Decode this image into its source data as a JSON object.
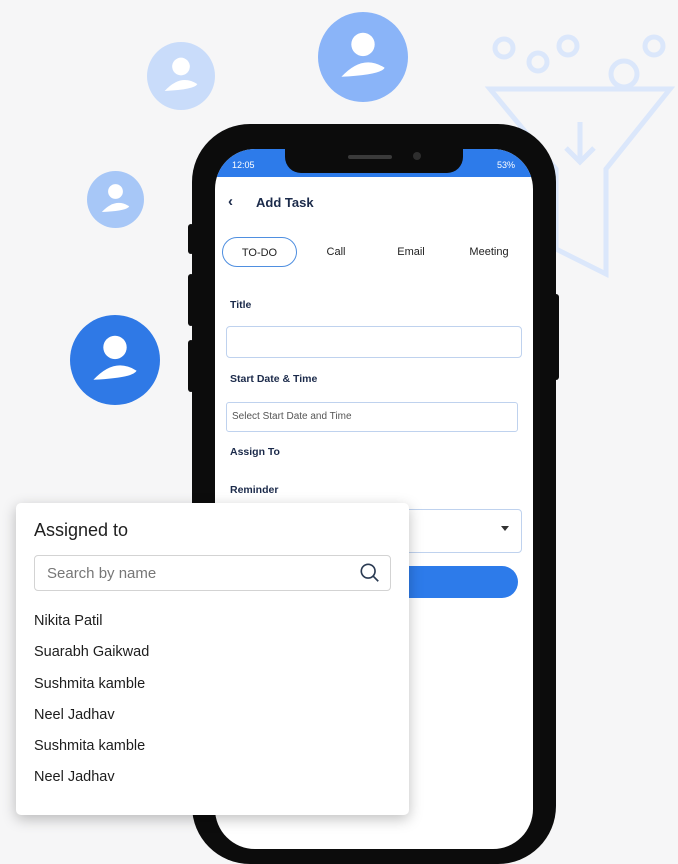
{
  "status_bar": {
    "time": "12:05",
    "right": "53%"
  },
  "header": {
    "back_icon": "chevron-left-icon",
    "title": "Add Task"
  },
  "tabs": [
    {
      "label": "TO-DO",
      "active": true
    },
    {
      "label": "Call",
      "active": false
    },
    {
      "label": "Email",
      "active": false
    },
    {
      "label": "Meeting",
      "active": false
    }
  ],
  "form": {
    "title_label": "Title",
    "title_value": "",
    "start_label": "Start Date & Time",
    "start_placeholder": "Select Start Date and Time",
    "assign_label": "Assign To",
    "reminder_label": "Reminder"
  },
  "popup": {
    "title": "Assigned to",
    "search_placeholder": "Search by name",
    "names": [
      "Nikita Patil",
      "Suarabh Gaikwad",
      "Sushmita kamble",
      "Neel Jadhav",
      "Sushmita kamble",
      "Neel Jadhav"
    ]
  },
  "colors": {
    "accent": "#2d7bea",
    "avatar_light": "#a7c7f7",
    "avatar_mid": "#8ab4f8",
    "avatar_dark": "#2f79e6"
  }
}
